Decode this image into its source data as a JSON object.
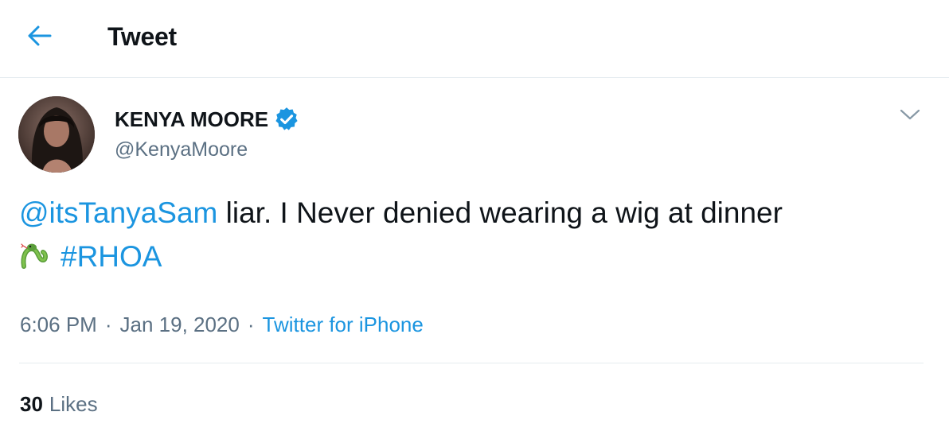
{
  "header": {
    "title": "Tweet",
    "back_icon": "arrow-left-icon"
  },
  "tweet": {
    "author": {
      "name": "KENYA MOORE",
      "handle": "@KenyaMoore",
      "verified": true,
      "verified_icon": "verified-badge-icon"
    },
    "text": {
      "mention": "@itsTanyaSam",
      "body": " liar. I Never denied wearing a wig at dinner",
      "emoji": "snake-emoji",
      "hashtag": "#RHOA"
    },
    "time": "6:06 PM",
    "separator": "·",
    "date": "Jan 19, 2020",
    "source": "Twitter for iPhone",
    "likes_count": "30",
    "likes_label": "Likes",
    "more_icon": "chevron-down-icon"
  },
  "colors": {
    "accent": "#1b95e0",
    "text": "#0f1419",
    "secondary": "#5b7083",
    "divider": "#e6ecf0"
  }
}
